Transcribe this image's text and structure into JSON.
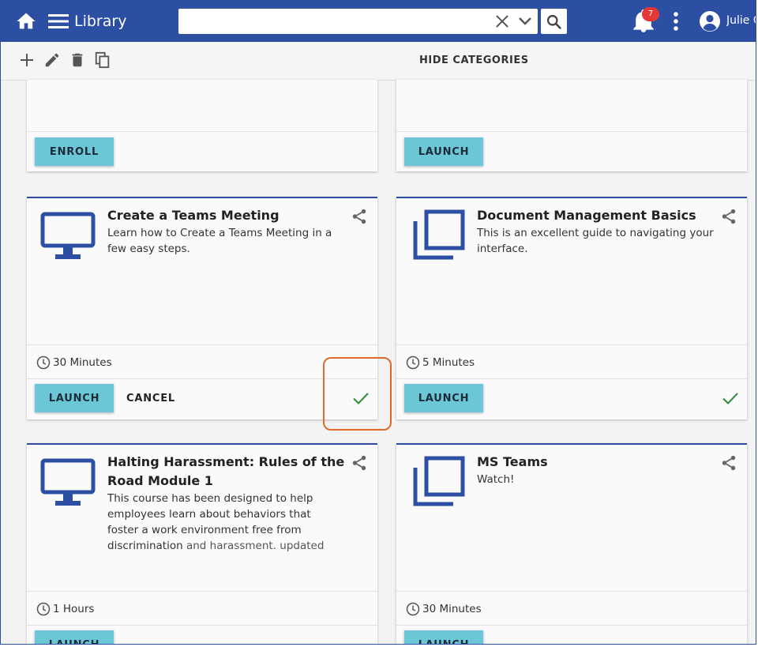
{
  "header": {
    "app_title": "Library",
    "search_value": "",
    "notification_count": "7",
    "user_name": "Julie C"
  },
  "toolbar": {
    "hide_categories": "HIDE CATEGORIES"
  },
  "colors": {
    "brand": "#2c4ea3",
    "button": "#6bc6d6",
    "check": "#2e8b3e",
    "highlight": "#e06a2b"
  },
  "cards": [
    {
      "primary_label": "ENROLL"
    },
    {
      "primary_label": "LAUNCH"
    },
    {
      "icon": "monitor-icon",
      "title": "Create a Teams Meeting",
      "description": "Learn how to Create a Teams Meeting in a few easy steps.",
      "duration": "30 Minutes",
      "primary_label": "LAUNCH",
      "secondary_label": "CANCEL",
      "completed": true
    },
    {
      "icon": "copy-icon",
      "title": "Document Management Basics",
      "description": "This is an excellent guide to navigating your interface.",
      "duration": "5 Minutes",
      "primary_label": "LAUNCH",
      "completed": true
    },
    {
      "icon": "monitor-icon",
      "title": "Halting Harassment: Rules of the Road Module 1",
      "description": "This course has been designed to help employees learn about behaviors that foster a work environment free from discrimination",
      "description_faded": "and harassment. updated",
      "duration": "1 Hours",
      "primary_label": "LAUNCH"
    },
    {
      "icon": "copy-icon",
      "title": "MS Teams",
      "description": "Watch!",
      "duration": "30 Minutes",
      "primary_label": "LAUNCH"
    }
  ]
}
